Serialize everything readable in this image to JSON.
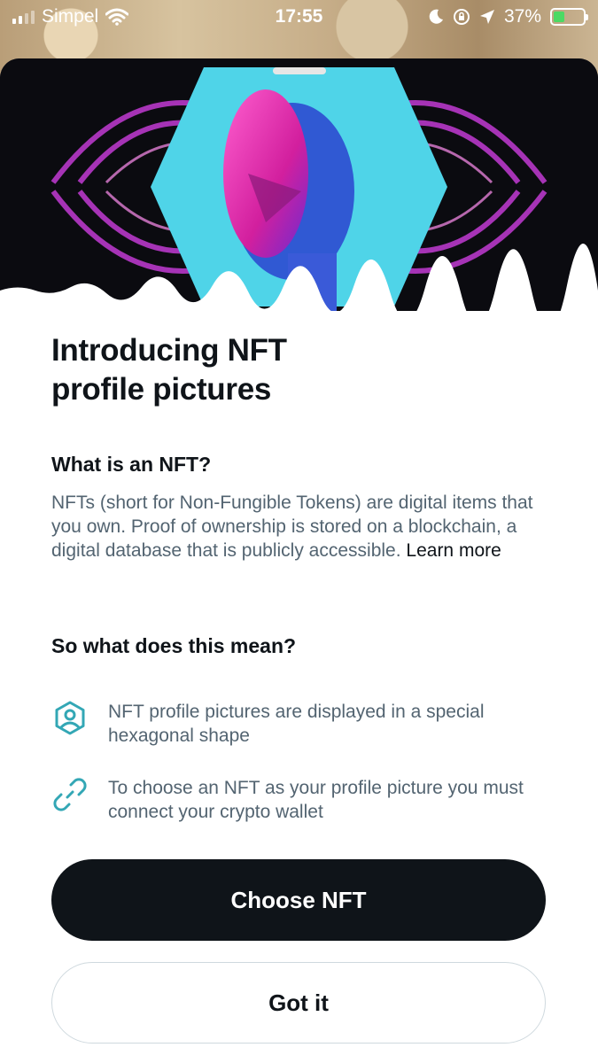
{
  "status_bar": {
    "carrier": "Simpel",
    "time": "17:55",
    "battery": "37%",
    "battery_level": 0.37
  },
  "sheet": {
    "title": "Introducing NFT profile pictures",
    "what_heading": "What is an NFT?",
    "what_body": "NFTs (short for Non-Fungible Tokens) are digital items that you own. Proof of ownership is stored on a blockchain, a digital database that is publicly accessible.",
    "learn_more": "Learn more",
    "mean_heading": "So what does this mean?",
    "features": [
      {
        "icon": "hexagon-profile-icon",
        "text": "NFT profile pictures are displayed in a special hexagonal shape"
      },
      {
        "icon": "link-icon",
        "text": "To choose an NFT as your profile picture you must connect your crypto wallet"
      }
    ],
    "primary_button": "Choose NFT",
    "secondary_button": "Got it"
  },
  "colors": {
    "accent": "#1d9bf0",
    "icon_teal": "#33a7b5",
    "text_primary": "#0f1419",
    "text_secondary": "#536471"
  }
}
